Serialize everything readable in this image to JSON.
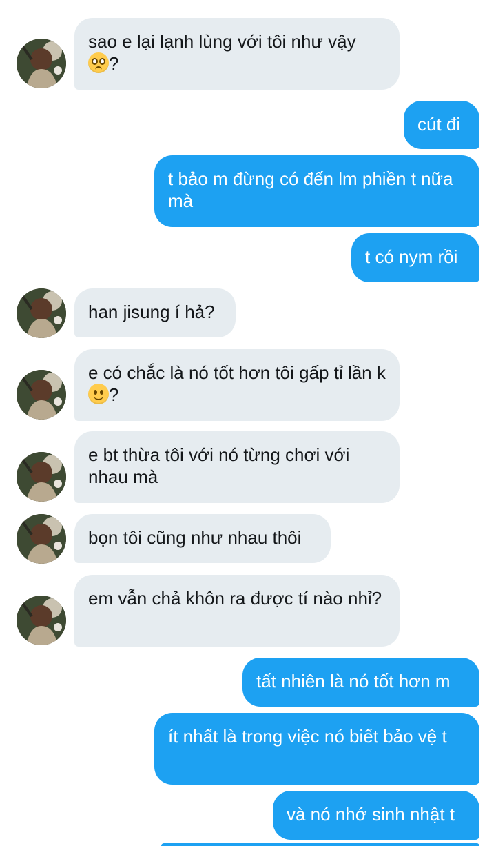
{
  "colors": {
    "incoming_bubble": "#e6ecf0",
    "outgoing_bubble": "#1da1f2",
    "incoming_text": "#14171a",
    "outgoing_text": "#ffffff"
  },
  "messages": [
    {
      "side": "in",
      "text": "sao e lại lạnh lùng với tôi như vậy",
      "emoji": "pleading-face-icon",
      "suffix": "?"
    },
    {
      "side": "out",
      "text": "cút đi"
    },
    {
      "side": "out",
      "text": "t bảo m đừng có đến lm phiền t nữa mà"
    },
    {
      "side": "out",
      "text": "t có nym rồi"
    },
    {
      "side": "in",
      "text": "han jisung í hả?"
    },
    {
      "side": "in",
      "text": "e có chắc là nó tốt hơn tôi gấp tỉ lần k ",
      "emoji": "slightly-smiling-face-icon",
      "suffix": "?"
    },
    {
      "side": "in",
      "text": "e bt thừa tôi với nó từng chơi với nhau mà"
    },
    {
      "side": "in",
      "text": "bọn tôi cũng như nhau thôi"
    },
    {
      "side": "in",
      "text": "em vẫn chả khôn ra được tí nào nhỉ?"
    },
    {
      "side": "out",
      "text": "tất nhiên là nó tốt hơn m"
    },
    {
      "side": "out",
      "text": "ít nhất là trong việc nó biết bảo vệ t"
    },
    {
      "side": "out",
      "text": "và nó nhớ sinh nhật t"
    }
  ]
}
